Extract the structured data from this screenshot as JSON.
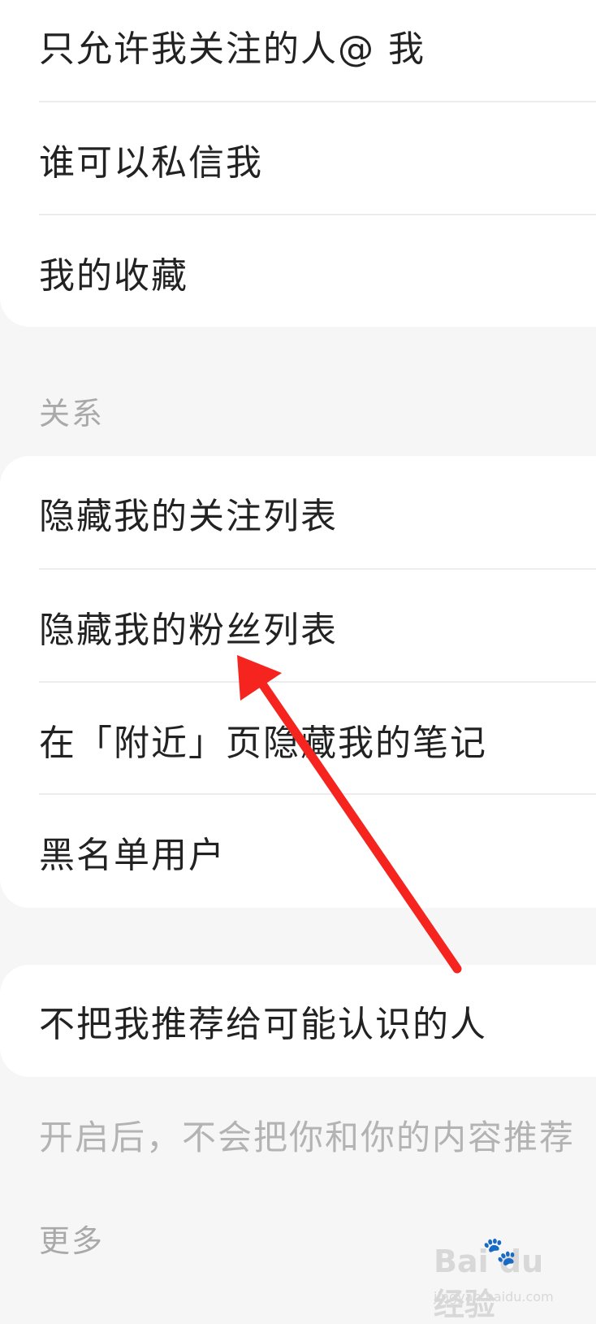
{
  "privacy_group": {
    "items": [
      {
        "label": "只允许我关注的人@ 我"
      },
      {
        "label": "谁可以私信我"
      },
      {
        "label": "我的收藏"
      }
    ]
  },
  "relations": {
    "section_label": "关系",
    "items": [
      {
        "label": "隐藏我的关注列表"
      },
      {
        "label": "隐藏我的粉丝列表"
      },
      {
        "label": "在「附近」页隐藏我的笔记"
      },
      {
        "label": "黑名单用户"
      }
    ]
  },
  "recommend": {
    "item_label": "不把我推荐给可能认识的人",
    "note": "开启后，不会把你和你的内容推荐"
  },
  "more": {
    "section_label": "更多"
  },
  "annotation": {
    "arrow_color": "#f5241f"
  },
  "watermark": {
    "logo_text": "Bai du 经验",
    "sub_text": "jingyan.baidu.com"
  }
}
